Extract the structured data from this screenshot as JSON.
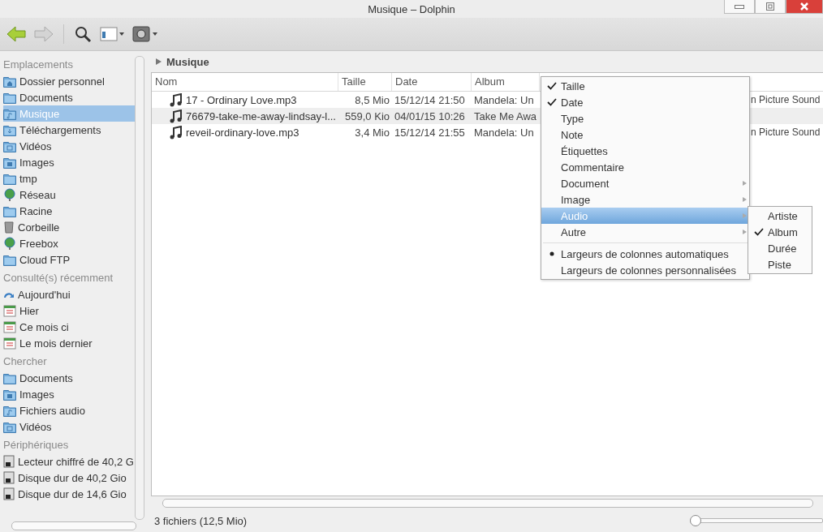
{
  "window": {
    "title": "Musique – Dolphin"
  },
  "sidebar": {
    "sections": [
      {
        "heading": "Emplacements",
        "items": [
          {
            "label": "Dossier personnel",
            "kind": "home",
            "selected": false
          },
          {
            "label": "Documents",
            "kind": "folder",
            "selected": false
          },
          {
            "label": "Musique",
            "kind": "music",
            "selected": true
          },
          {
            "label": "Téléchargements",
            "kind": "download",
            "selected": false
          },
          {
            "label": "Vidéos",
            "kind": "video",
            "selected": false
          },
          {
            "label": "Images",
            "kind": "image",
            "selected": false
          },
          {
            "label": "tmp",
            "kind": "folder",
            "selected": false
          },
          {
            "label": "Réseau",
            "kind": "globe",
            "selected": false
          },
          {
            "label": "Racine",
            "kind": "folder",
            "selected": false
          },
          {
            "label": "Corbeille",
            "kind": "trash",
            "selected": false
          },
          {
            "label": "Freebox",
            "kind": "globe",
            "selected": false
          },
          {
            "label": "Cloud FTP",
            "kind": "folder",
            "selected": false
          }
        ]
      },
      {
        "heading": "Consulté(s) récemment",
        "items": [
          {
            "label": "Aujourd'hui",
            "kind": "history",
            "selected": false
          },
          {
            "label": "Hier",
            "kind": "calendar",
            "selected": false
          },
          {
            "label": "Ce mois ci",
            "kind": "calendar",
            "selected": false
          },
          {
            "label": "Le mois dernier",
            "kind": "calendar",
            "selected": false
          }
        ]
      },
      {
        "heading": "Chercher",
        "items": [
          {
            "label": "Documents",
            "kind": "folder",
            "selected": false
          },
          {
            "label": "Images",
            "kind": "image",
            "selected": false
          },
          {
            "label": "Fichiers audio",
            "kind": "music",
            "selected": false
          },
          {
            "label": "Vidéos",
            "kind": "video",
            "selected": false
          }
        ]
      },
      {
        "heading": "Périphériques",
        "items": [
          {
            "label": "Lecteur chiffré de 40,2 G",
            "kind": "drive",
            "selected": false
          },
          {
            "label": "Disque dur de 40,2 Gio",
            "kind": "drive",
            "selected": false
          },
          {
            "label": "Disque dur de 14,6 Gio",
            "kind": "drive",
            "selected": false
          }
        ]
      }
    ]
  },
  "breadcrumb": "Musique",
  "table": {
    "columns": [
      "Nom",
      "Taille",
      "Date",
      "Album"
    ],
    "rows": [
      {
        "name": "17 - Ordinary Love.mp3",
        "size": "8,5 Mio",
        "date": "15/12/14 21:50",
        "album": "Mandela: Un",
        "column_5": "n Picture Sound",
        "selected": false
      },
      {
        "name": "76679-take-me-away-lindsay-l...",
        "size": "559,0 Kio",
        "date": "04/01/15 10:26",
        "album": "Take Me Awa",
        "selected": true
      },
      {
        "name": "reveil-ordinary-love.mp3",
        "size": "3,4 Mio",
        "date": "15/12/14 21:55",
        "album": "Mandela: Un",
        "column_5": "n Picture Sound",
        "selected": false
      }
    ]
  },
  "context_menu": {
    "items": [
      {
        "label": "Taille",
        "kind": "check",
        "checked": true,
        "selected": false
      },
      {
        "label": "Date",
        "kind": "check",
        "checked": true,
        "selected": false
      },
      {
        "label": "Type",
        "kind": "check",
        "checked": false,
        "selected": false
      },
      {
        "label": "Note",
        "kind": "check",
        "checked": false,
        "selected": false
      },
      {
        "label": "Étiquettes",
        "kind": "check",
        "checked": false,
        "selected": false
      },
      {
        "label": "Commentaire",
        "kind": "check",
        "checked": false,
        "selected": false
      },
      {
        "label": "Document",
        "kind": "submenu",
        "selected": false
      },
      {
        "label": "Image",
        "kind": "submenu",
        "selected": false
      },
      {
        "label": "Audio",
        "kind": "submenu",
        "selected": true
      },
      {
        "label": "Autre",
        "kind": "submenu",
        "selected": false
      },
      {
        "label": "Largeurs de colonnes automatiques",
        "kind": "radio",
        "checked": true,
        "selected": false
      },
      {
        "label": "Largeurs de colonnes personnalisées",
        "kind": "radio",
        "checked": false,
        "selected": false
      }
    ],
    "submenu": [
      {
        "label": "Artiste",
        "checked": false
      },
      {
        "label": "Album",
        "checked": true
      },
      {
        "label": "Durée",
        "checked": false
      },
      {
        "label": "Piste",
        "checked": false
      }
    ]
  },
  "status_bar": {
    "text": "3 fichiers (12,5 Mio)",
    "zoom": {
      "level": 0
    }
  }
}
